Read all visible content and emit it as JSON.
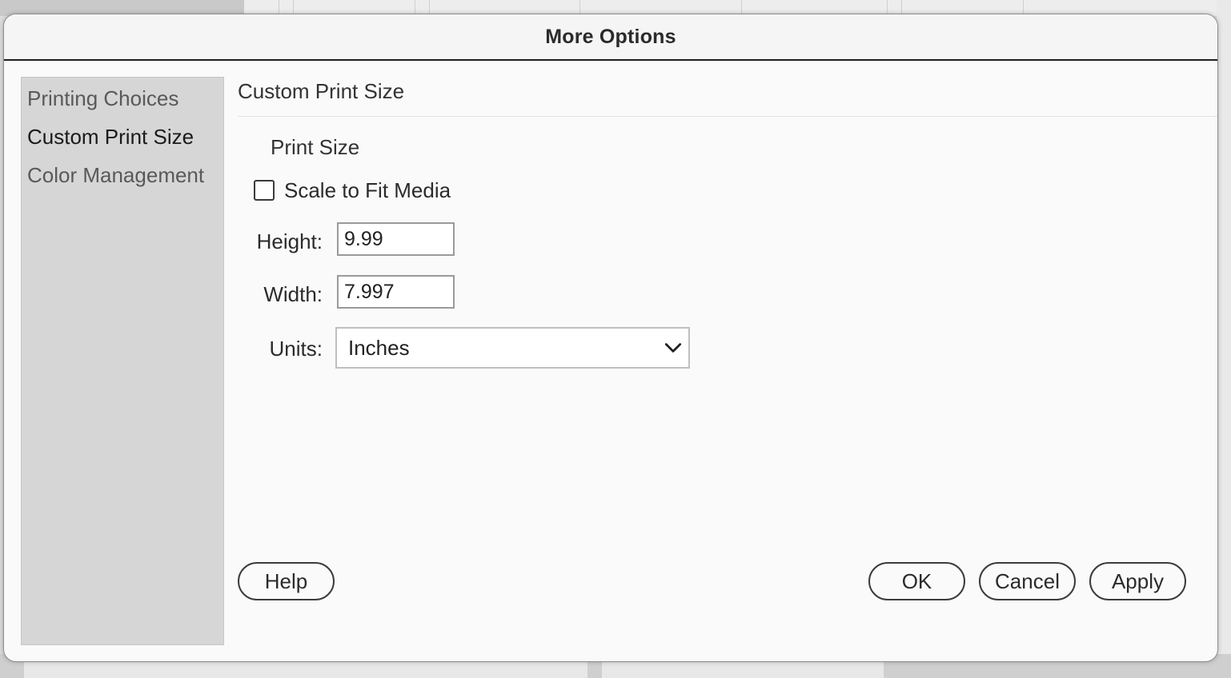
{
  "dialog": {
    "title": "More Options"
  },
  "sidebar": {
    "items": [
      {
        "label": "Printing Choices",
        "active": false
      },
      {
        "label": "Custom Print Size",
        "active": true
      },
      {
        "label": "Color Management",
        "active": false
      }
    ]
  },
  "main": {
    "section_title": "Custom Print Size",
    "group_label": "Print Size",
    "scale_to_fit": {
      "label": "Scale to Fit Media",
      "checked": false
    },
    "height": {
      "label": "Height:",
      "value": "9.99"
    },
    "width": {
      "label": "Width:",
      "value": "7.997"
    },
    "units": {
      "label": "Units:",
      "selected": "Inches"
    }
  },
  "buttons": {
    "help": "Help",
    "ok": "OK",
    "cancel": "Cancel",
    "apply": "Apply"
  },
  "icons": {
    "dropdown": "chevron-down-icon"
  },
  "colors": {
    "sidebar_bg": "#d6d6d6",
    "dialog_bg": "#fafafa",
    "title_rule": "#1e1e1e"
  }
}
